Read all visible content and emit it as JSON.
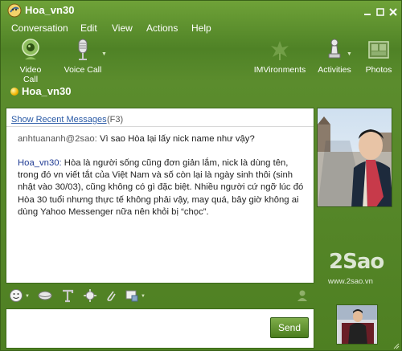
{
  "window": {
    "title": "Hoa_vn30"
  },
  "menu": {
    "items": [
      "Conversation",
      "Edit",
      "View",
      "Actions",
      "Help"
    ]
  },
  "toolbar": {
    "video_call": "Video Call",
    "voice_call": "Voice Call",
    "imvironments": "IMVironments",
    "activities": "Activities",
    "photos": "Photos"
  },
  "contact": {
    "name": "Hoa_vn30",
    "status_color": "#f0b400"
  },
  "chat": {
    "show_recent": "Show Recent Messages",
    "shortcut": "(F3)",
    "messages": [
      {
        "sender": "anhtuananh@2sao:",
        "text": "Vì sao Hòa lại lấy nick name như vậy?"
      },
      {
        "sender": "Hoa_vn30:",
        "text": "Hòa là người sống cũng đơn giản lắm, nick là dùng tên, trong đó vn viết tắt của Việt Nam và số còn lại là ngày sinh thôi (sinh nhật vào 30/03), cũng không có gì đặc biệt. Nhiều người cứ ngỡ lúc đó Hòa 30 tuổi nhưng thực tế không phải vậy, may quá, bây giờ không ai dùng Yahoo Messenger nữa nên khỏi bị “chọc”."
      }
    ]
  },
  "compose": {
    "send_label": "Send",
    "value": ""
  },
  "watermark": {
    "logo": "2Sao",
    "url": "www.2sao.vn"
  },
  "colors": {
    "frame_green": "#4f8226",
    "link_blue": "#2a5aa6",
    "sender_blue": "#1f3b94"
  }
}
